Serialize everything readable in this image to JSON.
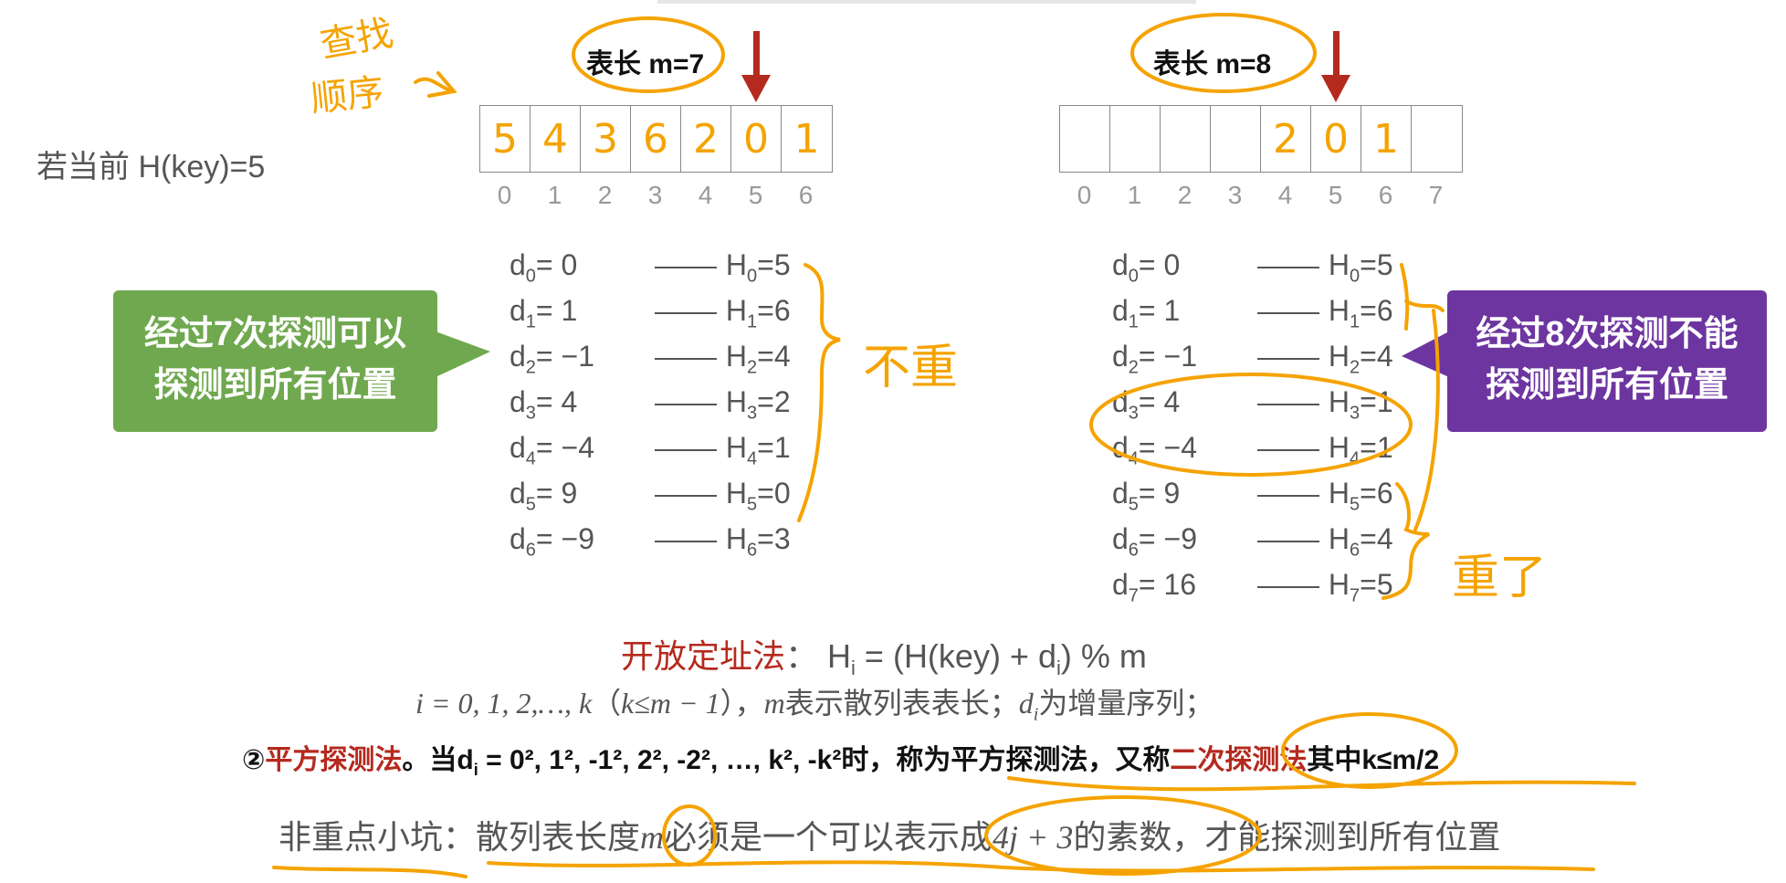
{
  "intro": "若当前 H(key)=5",
  "left_table": {
    "length_label": "表长 m=7",
    "cells": [
      "5",
      "4",
      "3",
      "6",
      "2",
      "0",
      "1"
    ],
    "indices": [
      "0",
      "1",
      "2",
      "3",
      "4",
      "5",
      "6"
    ],
    "probes": [
      {
        "d": "d",
        "di": "0",
        "dval": " = 0",
        "h": "H",
        "hi": "0",
        "hval": "=5"
      },
      {
        "d": "d",
        "di": "1",
        "dval": " = 1",
        "h": "H",
        "hi": "1",
        "hval": "=6"
      },
      {
        "d": "d",
        "di": "2",
        "dval": " = −1",
        "h": "H",
        "hi": "2",
        "hval": "=4"
      },
      {
        "d": "d",
        "di": "3",
        "dval": " = 4",
        "h": "H",
        "hi": "3",
        "hval": "=2"
      },
      {
        "d": "d",
        "di": "4",
        "dval": " = −4",
        "h": "H",
        "hi": "4",
        "hval": "=1"
      },
      {
        "d": "d",
        "di": "5",
        "dval": " = 9",
        "h": "H",
        "hi": "5",
        "hval": "=0"
      },
      {
        "d": "d",
        "di": "6",
        "dval": " = −9",
        "h": "H",
        "hi": "6",
        "hval": "=3"
      }
    ],
    "callout": [
      "经过7次探测可以",
      "探测到所有位置"
    ],
    "callout_color": "#6fa84e"
  },
  "right_table": {
    "length_label": "表长 m=8",
    "cells": [
      "",
      "",
      "",
      "",
      "2",
      "0",
      "1",
      ""
    ],
    "indices": [
      "0",
      "1",
      "2",
      "3",
      "4",
      "5",
      "6",
      "7"
    ],
    "probes": [
      {
        "d": "d",
        "di": "0",
        "dval": " = 0",
        "h": "H",
        "hi": "0",
        "hval": "=5"
      },
      {
        "d": "d",
        "di": "1",
        "dval": " = 1",
        "h": "H",
        "hi": "1",
        "hval": "=6"
      },
      {
        "d": "d",
        "di": "2",
        "dval": " = −1",
        "h": "H",
        "hi": "2",
        "hval": "=4"
      },
      {
        "d": "d",
        "di": "3",
        "dval": " = 4",
        "h": "H",
        "hi": "3",
        "hval": "=1"
      },
      {
        "d": "d",
        "di": "4",
        "dval": " = −4",
        "h": "H",
        "hi": "4",
        "hval": "=1"
      },
      {
        "d": "d",
        "di": "5",
        "dval": " = 9",
        "h": "H",
        "hi": "5",
        "hval": "=6"
      },
      {
        "d": "d",
        "di": "6",
        "dval": " = −9",
        "h": "H",
        "hi": "6",
        "hval": "=4"
      },
      {
        "d": "d",
        "di": "7",
        "dval": " = 16",
        "h": "H",
        "hi": "7",
        "hval": "=5"
      }
    ],
    "callout": [
      "经过8次探测不能",
      "探测到所有位置"
    ],
    "callout_color": "#6d35a0"
  },
  "annotations": {
    "search_order": [
      "查找",
      "顺序"
    ],
    "no_repeat": "不重",
    "repeated": "重了"
  },
  "formula": {
    "method": "开放定址法",
    "colon": "：",
    "rest_pre": " H",
    "rest_i": "i",
    "rest_mid": " = (H(key) + d",
    "rest_i2": "i",
    "rest_post": ") % m"
  },
  "range_line": {
    "italic1": "i = 0, 1, 2,…, k",
    "paren": "（",
    "italic2": "k≤m − 1",
    "paren_close": "）",
    "comma": "，",
    "m": "m",
    "text1": "表示散列表表长；",
    "d": "d",
    "di": "i",
    "text2": "为增量序列；"
  },
  "square_probe": {
    "circle": "②",
    "name": "平方探测法",
    "part1": "。当d",
    "sub_i": "i",
    "part2": " = 0",
    "seq": "², 1², -1², 2², -2², …, k², -k²",
    "part3": "时，称为平方探测法，又称",
    "alt_name": "二次探测法",
    "part4": "其中k≤m/2"
  },
  "pitfall": {
    "text1": "非重点小坑：散列表长度",
    "m": "m",
    "text2": "必须是一个可以表示成",
    "expr": "4j + 3",
    "text3": "的素数，才能探测到所有位置"
  },
  "colors": {
    "accent_red": "#b52a1e",
    "ink_orange": "#f5a300",
    "green": "#6fa84e",
    "purple": "#6d35a0"
  }
}
